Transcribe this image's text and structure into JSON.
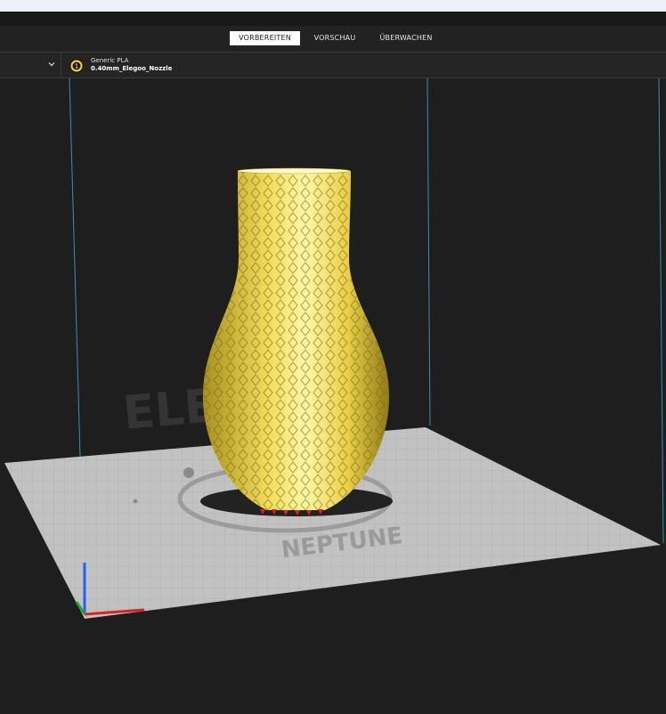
{
  "stages": [
    {
      "label": "VORBEREITEN",
      "active": true
    },
    {
      "label": "VORSCHAU",
      "active": false
    },
    {
      "label": "ÜBERWACHEN",
      "active": false
    }
  ],
  "extruder": {
    "number": "1",
    "material": "Generic PLA",
    "nozzle": "0.40mm_Elegoo_Nozzle"
  },
  "bed": {
    "logo_text": "ELEGOO",
    "model_text": "NEPTUNE"
  },
  "colors": {
    "model": "#f5e05a",
    "model_shadow": "#a48a1e",
    "bed": "#c2c2c2",
    "grid": "#adadad",
    "axis_x": "#e02020",
    "axis_y": "#22aa22",
    "axis_z": "#2060ff",
    "volume_edge": "#3a8fb5"
  },
  "icons": {
    "printer_dropdown": "chevron-down-icon",
    "extruder": "extruder-icon"
  }
}
